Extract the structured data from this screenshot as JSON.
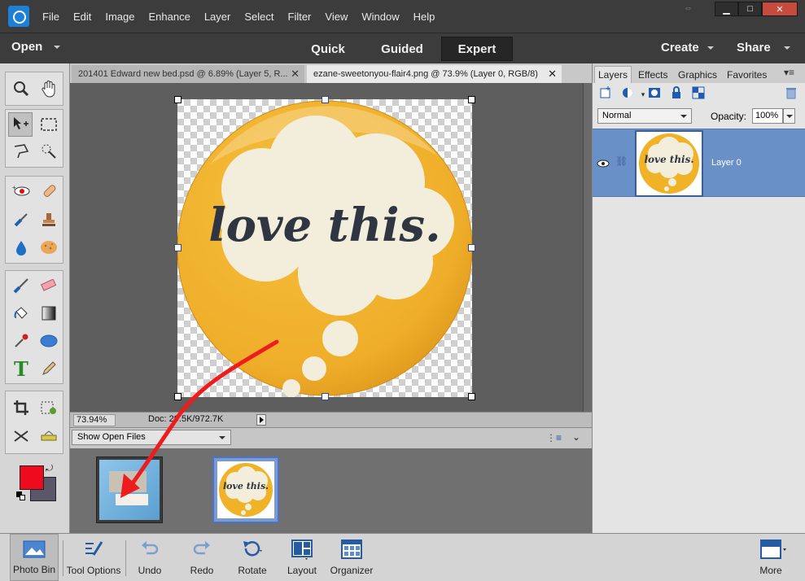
{
  "menu": [
    "File",
    "Edit",
    "Image",
    "Enhance",
    "Layer",
    "Select",
    "Filter",
    "View",
    "Window",
    "Help"
  ],
  "window_controls": {
    "restore_glyph": "⇔",
    "minimize": "▁",
    "maximize": "□",
    "close": "✕"
  },
  "modebar": {
    "open_label": "Open",
    "tabs": [
      "Quick",
      "Guided",
      "Expert"
    ],
    "active_tab": "Expert",
    "create_label": "Create",
    "share_label": "Share"
  },
  "doc_tabs": [
    {
      "title": "201401 Edward new bed.psd @ 6.89% (Layer 5, R...",
      "active": false
    },
    {
      "title": "ezane-sweetonyou-flair4.png @ 73.9% (Layer 0, RGB/8)",
      "active": true
    }
  ],
  "canvas": {
    "art_text": "love this."
  },
  "status": {
    "zoom": "73.94%",
    "doc_size": "Doc: 29.5K/972.7K"
  },
  "photo_bin": {
    "dropdown_label": "Show Open Files"
  },
  "panel_tabs": [
    "Layers",
    "Effects",
    "Graphics",
    "Favorites"
  ],
  "layers": {
    "blend_mode": "Normal",
    "opacity_label": "Opacity:",
    "opacity_value": "100%",
    "layer_name": "Layer 0",
    "thumb_text": "love this."
  },
  "taskbar": [
    {
      "label": "Photo Bin",
      "icon": "photo-bin-icon"
    },
    {
      "label": "Tool Options",
      "icon": "tool-options-icon"
    },
    {
      "label": "Undo",
      "icon": "undo-icon"
    },
    {
      "label": "Redo",
      "icon": "redo-icon"
    },
    {
      "label": "Rotate",
      "icon": "rotate-icon"
    },
    {
      "label": "Layout",
      "icon": "layout-icon"
    },
    {
      "label": "Organizer",
      "icon": "organizer-icon"
    },
    {
      "label": "More",
      "icon": "more-icon"
    }
  ],
  "colors": {
    "foreground": "#ef0b1e",
    "background": "#5a576a",
    "art_fill": "#f0b328",
    "art_cloud": "#f3eedb",
    "art_text": "#2f3641",
    "arrow": "#ee1c1c"
  }
}
